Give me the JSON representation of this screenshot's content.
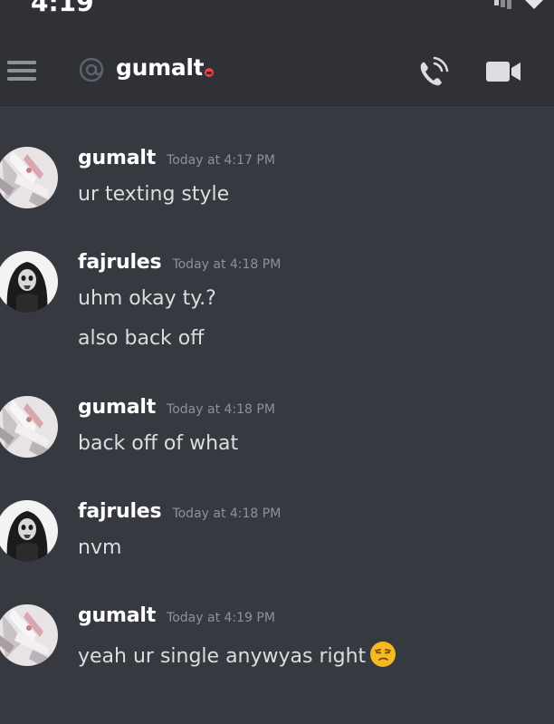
{
  "status_bar": {
    "time": "4:19"
  },
  "header": {
    "channel_name": "gumalt"
  },
  "messages": [
    {
      "author": "gumalt",
      "timestamp": "Today at 4:17 PM",
      "lines": [
        "ur texting style"
      ],
      "avatar": "gumalt-avatar"
    },
    {
      "author": "fajrules",
      "timestamp": "Today at 4:18 PM",
      "lines": [
        "uhm okay ty.?",
        "also back off"
      ],
      "avatar": "fajrules-avatar"
    },
    {
      "author": "gumalt",
      "timestamp": "Today at 4:18 PM",
      "lines": [
        "back off of what"
      ],
      "avatar": "gumalt-avatar"
    },
    {
      "author": "fajrules",
      "timestamp": "Today at 4:18 PM",
      "lines": [
        "nvm"
      ],
      "avatar": "fajrules-avatar"
    },
    {
      "author": "gumalt",
      "timestamp": "Today at 4:19 PM",
      "lines": [
        "yeah ur single anywyas right"
      ],
      "avatar": "gumalt-avatar",
      "emoji": "unamused-face-emoji"
    }
  ],
  "colors": {
    "background": "#36393f",
    "header": "#2f3136",
    "dnd_status": "#ed4245",
    "timestamp": "#8e9297",
    "text": "#dcddde"
  }
}
